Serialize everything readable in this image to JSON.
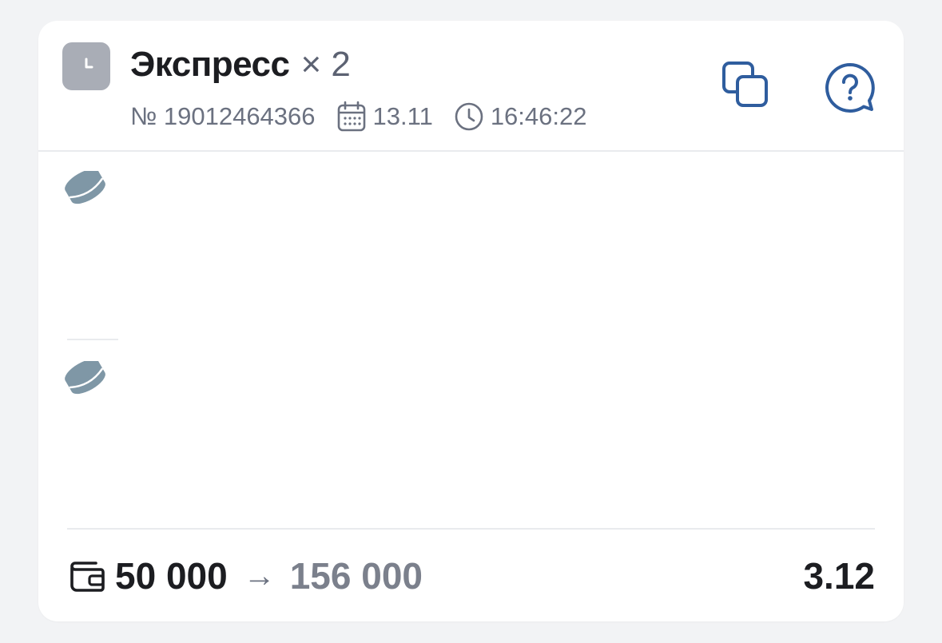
{
  "bet": {
    "title": "Экспресс",
    "multiplier": "× 2",
    "number": "№ 19012464366",
    "date": "13.11",
    "time": "16:46:22"
  },
  "events": [
    {
      "sport_icon": "hockey-puck-icon"
    },
    {
      "sport_icon": "hockey-puck-icon"
    }
  ],
  "footer": {
    "stake": "50 000",
    "arrow": "→",
    "payout": "156 000",
    "coefficient": "3.12"
  },
  "icons": {
    "status": "clock-icon",
    "copy": "copy-icon",
    "help": "help-chat-icon",
    "date": "calendar-icon",
    "time": "clock-icon",
    "wallet": "wallet-icon"
  },
  "colors": {
    "accent": "#2f5d9e",
    "puck": "#7f97a6",
    "status_badge": "#a9adb6"
  }
}
